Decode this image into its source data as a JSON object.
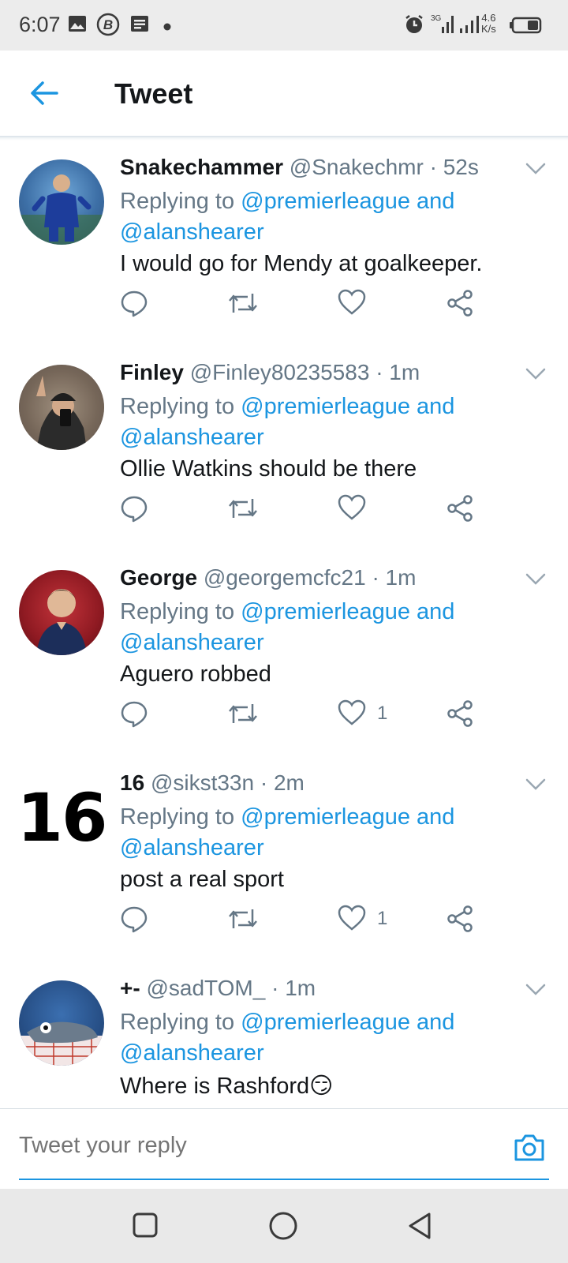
{
  "status_bar": {
    "time": "6:07",
    "net_speed_value": "4.6",
    "net_speed_unit": "K/s",
    "icons": [
      "gallery-icon",
      "b-badge-icon",
      "message-icon",
      "dot-icon",
      "alarm-icon",
      "signal-icon",
      "signal-icon",
      "battery-icon"
    ]
  },
  "header": {
    "title": "Tweet"
  },
  "tweets": [
    {
      "name": "Snakechammer",
      "handle": "@Snakechmr",
      "time": "· 52s",
      "replying_prefix": "Replying to",
      "mention1": "@premierleague and",
      "mention2": "@alanshearer",
      "text": "I would go for Mendy at goalkeeper.",
      "likes": ""
    },
    {
      "name": "Finley",
      "handle": "@Finley80235583",
      "time": "· 1m",
      "replying_prefix": "Replying to",
      "mention1": "@premierleague and",
      "mention2": "@alanshearer",
      "text": "Ollie Watkins should be there",
      "likes": ""
    },
    {
      "name": "George",
      "handle": "@georgemcfc21",
      "time": "· 1m",
      "replying_prefix": "Replying to",
      "mention1": "@premierleague and",
      "mention2": "@alanshearer",
      "text": "Aguero robbed",
      "likes": "1"
    },
    {
      "name": "16",
      "handle": "@sikst33n",
      "time": "· 2m",
      "replying_prefix": "Replying to",
      "mention1": "@premierleague and",
      "mention2": "@alanshearer",
      "text": "post a real sport",
      "likes": "1",
      "avatar_text": "16"
    },
    {
      "name": "+-",
      "handle": "@sadTOM_",
      "time": "· 1m",
      "replying_prefix": "Replying to",
      "mention1": "@premierleague and",
      "mention2": "@alanshearer",
      "text": "Where is Rashford😏",
      "likes": ""
    }
  ],
  "composer": {
    "placeholder": "Tweet your reply"
  },
  "colors": {
    "accent": "#1b95e0",
    "secondary_text": "#657786",
    "primary_text": "#14171a",
    "divider": "#d6dde3"
  }
}
